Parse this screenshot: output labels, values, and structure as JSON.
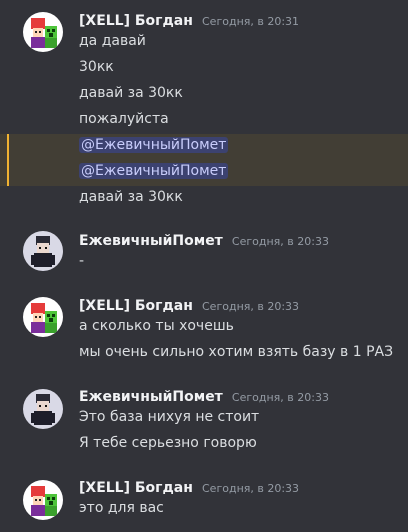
{
  "messages": [
    {
      "author": "[XELL] Богдан",
      "timestamp": "Сегодня, в 20:31",
      "avatar_icon": "user-avatar-bogdan",
      "lines": [
        "да давай",
        "30кк",
        "давай за 30кк",
        "пожалуйста",
        "@ЕжевичныйПомет",
        "@ЕжевичныйПомет",
        "давай за 30кк"
      ]
    },
    {
      "author": "ЕжевичныйПомет",
      "timestamp": "Сегодня, в 20:33",
      "avatar_icon": "user-avatar-ezhevichny",
      "lines": [
        "-"
      ]
    },
    {
      "author": "[XELL] Богдан",
      "timestamp": "Сегодня, в 20:33",
      "avatar_icon": "user-avatar-bogdan",
      "lines": [
        "а сколько ты хочешь",
        "мы очень сильно хотим взять базу в 1 РАЗ"
      ]
    },
    {
      "author": "ЕжевичныйПомет",
      "timestamp": "Сегодня, в 20:33",
      "avatar_icon": "user-avatar-ezhevichny",
      "lines": [
        "Это база нихуя не стоит",
        "Я тебе серьезно говорю"
      ]
    },
    {
      "author": "[XELL] Богдан",
      "timestamp": "Сегодня, в 20:33",
      "avatar_icon": "user-avatar-bogdan",
      "lines": [
        "это для вас"
      ]
    }
  ],
  "colors": {
    "background": "#323339",
    "mention_highlight": "#423e35",
    "mention_bar": "#f0b232",
    "mention_pill": "#3c4270"
  }
}
